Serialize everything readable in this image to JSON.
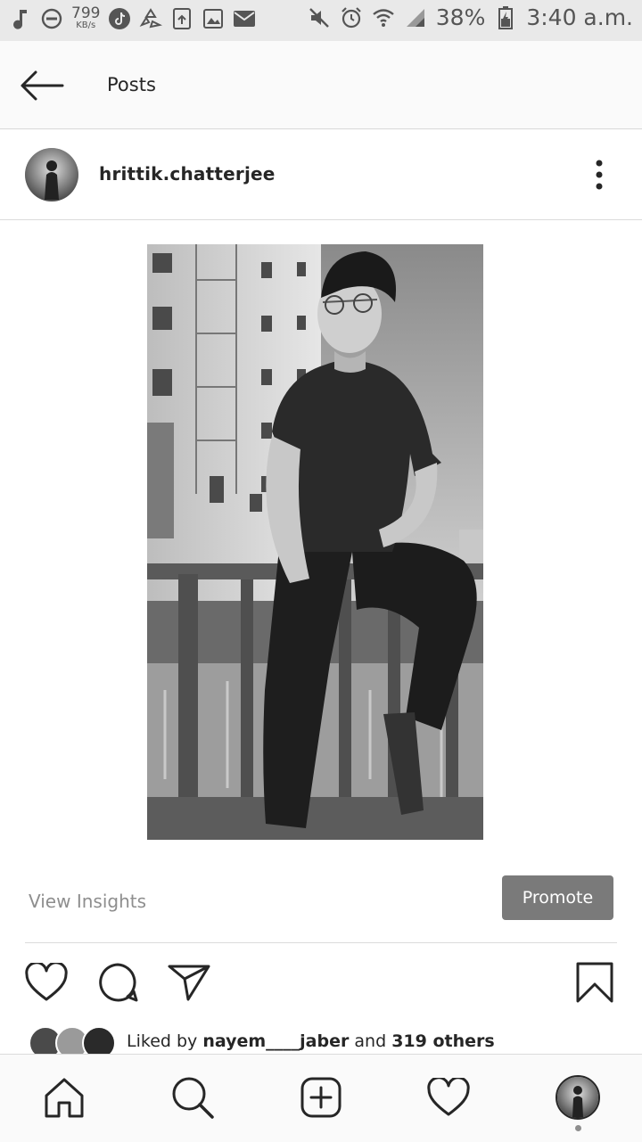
{
  "status_bar": {
    "speed_value": "799",
    "speed_unit": "KB/s",
    "battery": "38%",
    "time": "3:40 a.m.",
    "left_icons": [
      "music-note-icon",
      "do-not-disturb-icon",
      "speed-indicator",
      "tiktok-icon",
      "recycle-icon",
      "screenshot-icon",
      "gallery-icon",
      "mail-icon"
    ],
    "right_icons": [
      "mute-icon",
      "alarm-icon",
      "wifi-icon",
      "signal-icon",
      "battery-icon"
    ]
  },
  "header": {
    "title": "Posts",
    "back_icon": "back-arrow-icon"
  },
  "post": {
    "username": "hrittik.chatterjee",
    "more_icon": "more-vertical-icon",
    "photo_icon": "post-photo",
    "view_insights": "View Insights",
    "promote": "Promote",
    "actions": [
      "heart-icon",
      "comment-icon",
      "send-icon",
      "bookmark-icon"
    ],
    "likes": {
      "prefix": "Liked by ",
      "user": "nayem____jaber",
      "middle": " and ",
      "others": "319 others"
    }
  },
  "bottom_nav": {
    "items": [
      "home-icon",
      "search-icon",
      "add-post-icon",
      "activity-heart-icon",
      "profile-avatar"
    ]
  },
  "colors": {
    "accent": "#262626",
    "promote_bg": "#7a7a7a",
    "muted_text": "#8e8e8e",
    "divider": "#dbdbdb"
  }
}
